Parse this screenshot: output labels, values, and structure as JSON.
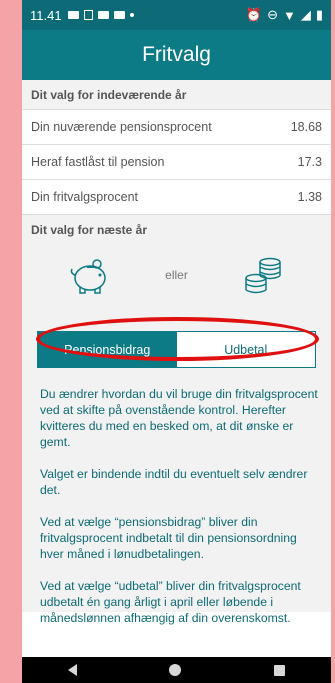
{
  "status": {
    "time": "11.41"
  },
  "app": {
    "title": "Fritvalg"
  },
  "current": {
    "header": "Dit valg for indeværende år",
    "rows": [
      {
        "label": "Din nuværende pensionsprocent",
        "value": "18.68"
      },
      {
        "label": "Heraf fastlåst til pension",
        "value": "17.3"
      },
      {
        "label": "Din fritvalgsprocent",
        "value": "1.38"
      }
    ]
  },
  "next": {
    "header": "Dit valg for næste år",
    "or_label": "eller",
    "toggle": {
      "left": "Pensionsbidrag",
      "right": "Udbetal"
    },
    "paragraphs": [
      "Du ændrer hvordan du vil bruge din fritvalgsprocent ved at skifte på ovenstående kontrol. Herefter kvitteres du med en besked om, at dit ønske er gemt.",
      "Valget er bindende indtil du eventuelt selv ændrer det.",
      "Ved at vælge “pensionsbidrag” bliver din fritvalgsprocent indbetalt til din pensionsordning hver måned i lønudbetalingen.",
      "Ved at vælge “udbetal” bliver din fritvalgsprocent udbetalt én gang årligt i april eller løbende i månedslønnen afhængig af din overenskomst."
    ]
  },
  "colors": {
    "primary": "#0c7b86",
    "annotation": "#e01010",
    "background": "#f4a3a6"
  }
}
